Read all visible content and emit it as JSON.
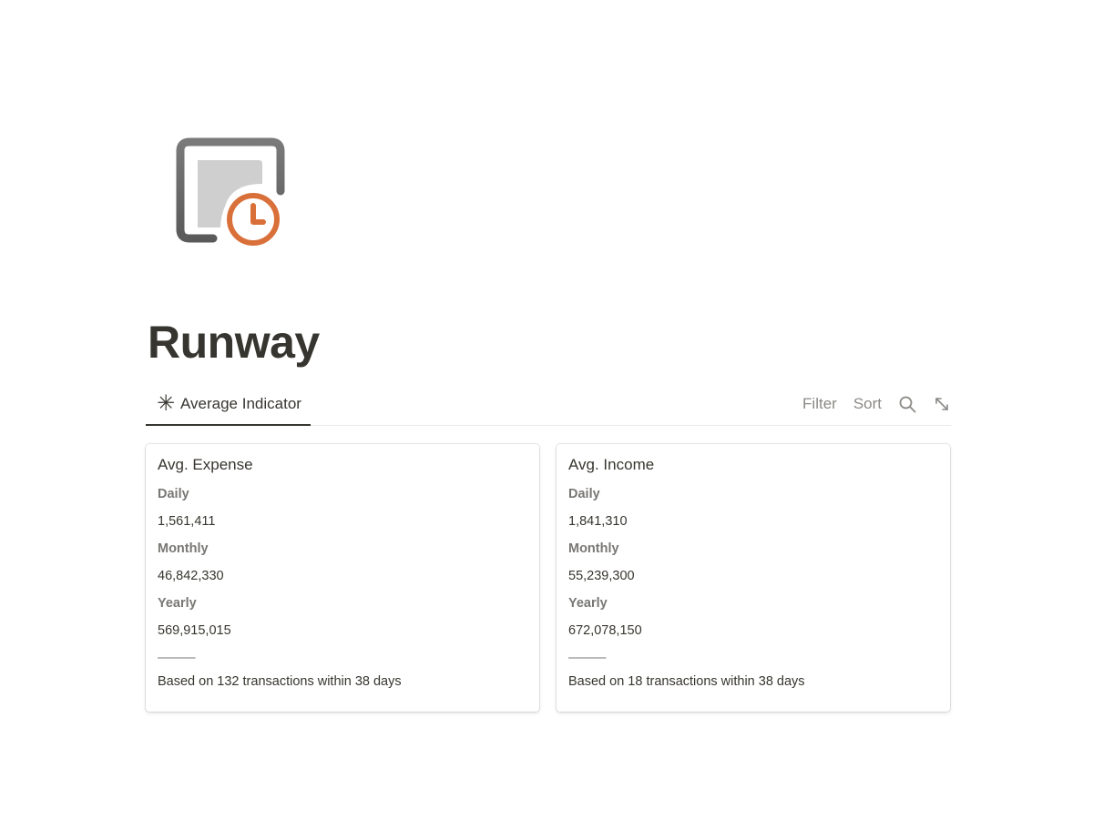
{
  "page": {
    "icon": "clipboard-clock-icon",
    "title": "Runway"
  },
  "view": {
    "tab_icon": "asterisk-icon",
    "tab_label": "Average Indicator",
    "tab_glyph": "✳"
  },
  "toolbar": {
    "filter_label": "Filter",
    "sort_label": "Sort",
    "search_icon": "search-icon",
    "expand_icon": "expand-icon"
  },
  "cards": [
    {
      "title": "Avg. Expense",
      "daily_label": "Daily",
      "daily_value": "1,561,411",
      "monthly_label": "Monthly",
      "monthly_value": "46,842,330",
      "yearly_label": "Yearly",
      "yearly_value": "569,915,015",
      "divider": "———",
      "note": "Based on 132 transactions within 38 days"
    },
    {
      "title": "Avg. Income",
      "daily_label": "Daily",
      "daily_value": "1,841,310",
      "monthly_label": "Monthly",
      "monthly_value": "55,239,300",
      "yearly_label": "Yearly",
      "yearly_value": "672,078,150",
      "divider": "———",
      "note": "Based on 18 transactions within 38 days"
    }
  ],
  "colors": {
    "accent_orange": "#d9703a",
    "icon_gray": "#6b6b6b",
    "text": "#37352f",
    "muted": "#787774"
  }
}
